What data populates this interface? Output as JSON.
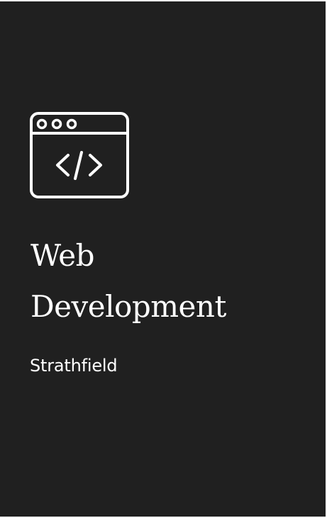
{
  "card": {
    "background": "#202020",
    "text_color": "#ffffff",
    "icon": "code-window-icon",
    "title_lines": [
      "Web",
      "Development"
    ],
    "location": "Strathfield"
  }
}
